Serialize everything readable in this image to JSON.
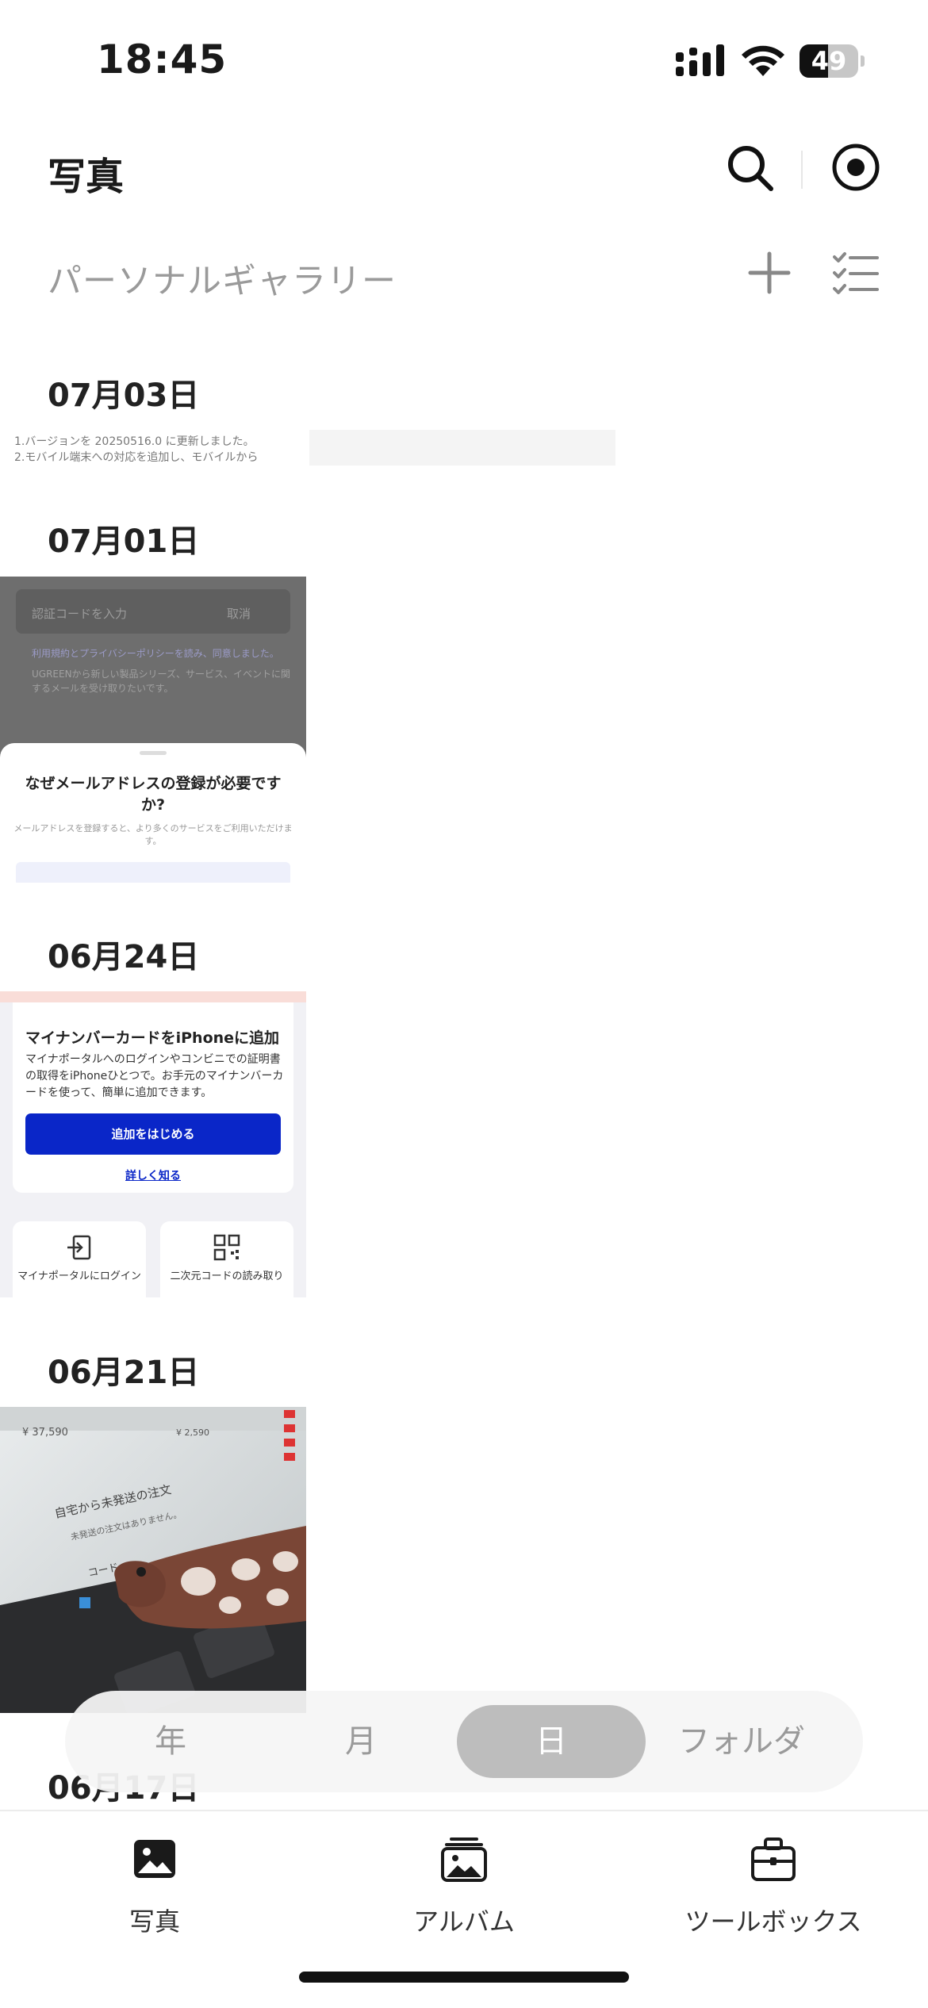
{
  "status_bar": {
    "time": "18:45",
    "battery": "49",
    "battery_level": 0.49
  },
  "header": {
    "title": "写真"
  },
  "section": {
    "title": "パーソナルギャラリー"
  },
  "groups": [
    {
      "date": "07月03日"
    },
    {
      "date": "07月01日"
    },
    {
      "date": "06月24日"
    },
    {
      "date": "06月21日"
    },
    {
      "date": "06月17日"
    }
  ],
  "thumbs": {
    "t1": {
      "line1": "1.バージョンを 20250516.0 に更新しました。",
      "line2": "2.モバイル端末への対応を追加し、モバイルから"
    },
    "t2": {
      "field": "認証コードを入力",
      "cancel": "取消",
      "policy": "利用規約とプライバシーポリシーを読み、同意しました。",
      "newsletter": "UGREENから新しい製品シリーズ、サービス、イベントに関するメールを受け取りたいです。",
      "sheet_title": "なぜメールアドレスの登録が必要ですか?",
      "sheet_desc": "メールアドレスを登録すると、より多くのサービスをご利用いただけます。"
    },
    "t3": {
      "card_title": "マイナンバーカードをiPhoneに追加",
      "card_desc": "マイナポータルへのログインやコンビニでの証明書の取得をiPhoneひとつで。お手元のマイナンバーカードを使って、簡単に追加できます。",
      "button": "追加をはじめる",
      "link": "詳しく知る",
      "tile_left": "マイナポータルにログイン",
      "tile_right": "二次元コードの読み取り"
    },
    "t4": {
      "price": "¥ 37,590",
      "price2": "¥ 2,590",
      "headline": "自宅から未発送の注文",
      "sub": "未発送の注文はありません。",
      "code": "コード"
    }
  },
  "segment": {
    "items": [
      "年",
      "月",
      "日",
      "フォルダ"
    ],
    "active": "日"
  },
  "tabs": [
    {
      "label": "写真",
      "icon": "photo-icon"
    },
    {
      "label": "アルバム",
      "icon": "album-icon"
    },
    {
      "label": "ツールボックス",
      "icon": "toolbox-icon"
    }
  ]
}
